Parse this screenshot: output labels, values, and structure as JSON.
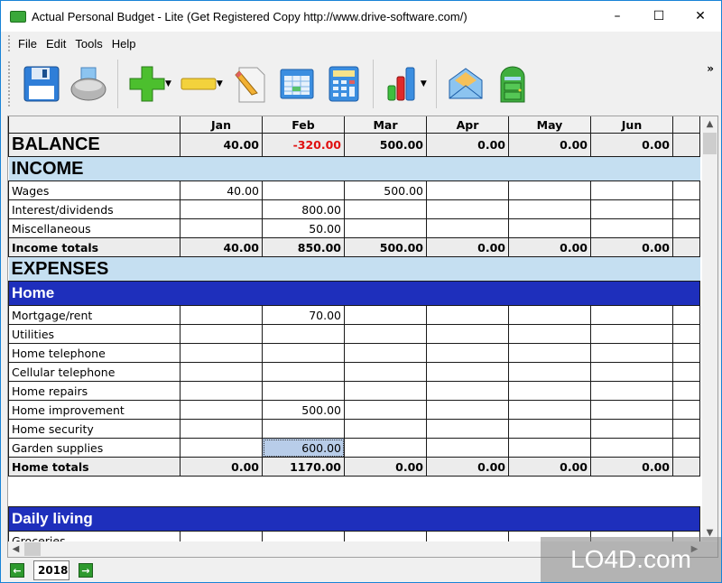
{
  "window": {
    "title": "Actual Personal Budget - Lite (Get Registered Copy http://www.drive-software.com/)",
    "controls": {
      "minimize": "–",
      "maximize": "☐",
      "close": "✕"
    }
  },
  "menu": [
    "File",
    "Edit",
    "Tools",
    "Help"
  ],
  "toolbar": {
    "buttons": [
      {
        "name": "save",
        "icon": "floppy-disk-icon"
      },
      {
        "name": "print",
        "icon": "printer-icon"
      },
      {
        "name": "add",
        "icon": "green-plus-icon",
        "dropdown": true
      },
      {
        "name": "remove",
        "icon": "yellow-minus-icon",
        "dropdown": true
      },
      {
        "name": "edit",
        "icon": "document-pencil-icon"
      },
      {
        "name": "spreadsheet",
        "icon": "spreadsheet-icon"
      },
      {
        "name": "calculator",
        "icon": "calculator-icon"
      },
      {
        "name": "chart",
        "icon": "bar-chart-icon",
        "dropdown": true
      },
      {
        "name": "email",
        "icon": "envelope-icon"
      },
      {
        "name": "exit",
        "icon": "green-door-icon"
      }
    ],
    "overflow": "»"
  },
  "grid": {
    "columns": [
      "",
      "Jan",
      "Feb",
      "Mar",
      "Apr",
      "May",
      "Jun"
    ],
    "balance": {
      "label": "BALANCE",
      "values": [
        "40.00",
        "-320.00",
        "500.00",
        "0.00",
        "0.00",
        "0.00"
      ]
    },
    "income": {
      "title": "INCOME",
      "rows": [
        {
          "label": "Wages",
          "values": [
            "40.00",
            "",
            "500.00",
            "",
            "",
            ""
          ]
        },
        {
          "label": "Interest/dividends",
          "values": [
            "",
            "800.00",
            "",
            "",
            "",
            ""
          ]
        },
        {
          "label": "Miscellaneous",
          "values": [
            "",
            "50.00",
            "",
            "",
            "",
            ""
          ]
        }
      ],
      "totals": {
        "label": "Income totals",
        "values": [
          "40.00",
          "850.00",
          "500.00",
          "0.00",
          "0.00",
          "0.00"
        ]
      }
    },
    "expenses": {
      "title": "EXPENSES",
      "home": {
        "title": "Home",
        "rows": [
          {
            "label": "Mortgage/rent",
            "values": [
              "",
              "70.00",
              "",
              "",
              "",
              ""
            ]
          },
          {
            "label": "Utilities",
            "values": [
              "",
              "",
              "",
              "",
              "",
              ""
            ]
          },
          {
            "label": "Home telephone",
            "values": [
              "",
              "",
              "",
              "",
              "",
              ""
            ]
          },
          {
            "label": "Cellular telephone",
            "values": [
              "",
              "",
              "",
              "",
              "",
              ""
            ]
          },
          {
            "label": "Home repairs",
            "values": [
              "",
              "",
              "",
              "",
              "",
              ""
            ]
          },
          {
            "label": "Home improvement",
            "values": [
              "",
              "500.00",
              "",
              "",
              "",
              ""
            ]
          },
          {
            "label": "Home security",
            "values": [
              "",
              "",
              "",
              "",
              "",
              ""
            ]
          },
          {
            "label": "Garden supplies",
            "values": [
              "",
              "600.00",
              "",
              "",
              "",
              ""
            ]
          }
        ],
        "totals": {
          "label": "Home totals",
          "values": [
            "0.00",
            "1170.00",
            "0.00",
            "0.00",
            "0.00",
            "0.00"
          ]
        }
      },
      "daily_living": {
        "title": "Daily living",
        "first_row": "Groceries"
      }
    }
  },
  "status": {
    "year": "2018",
    "prev": "←",
    "next": "→"
  },
  "watermark": "LO4D.com"
}
